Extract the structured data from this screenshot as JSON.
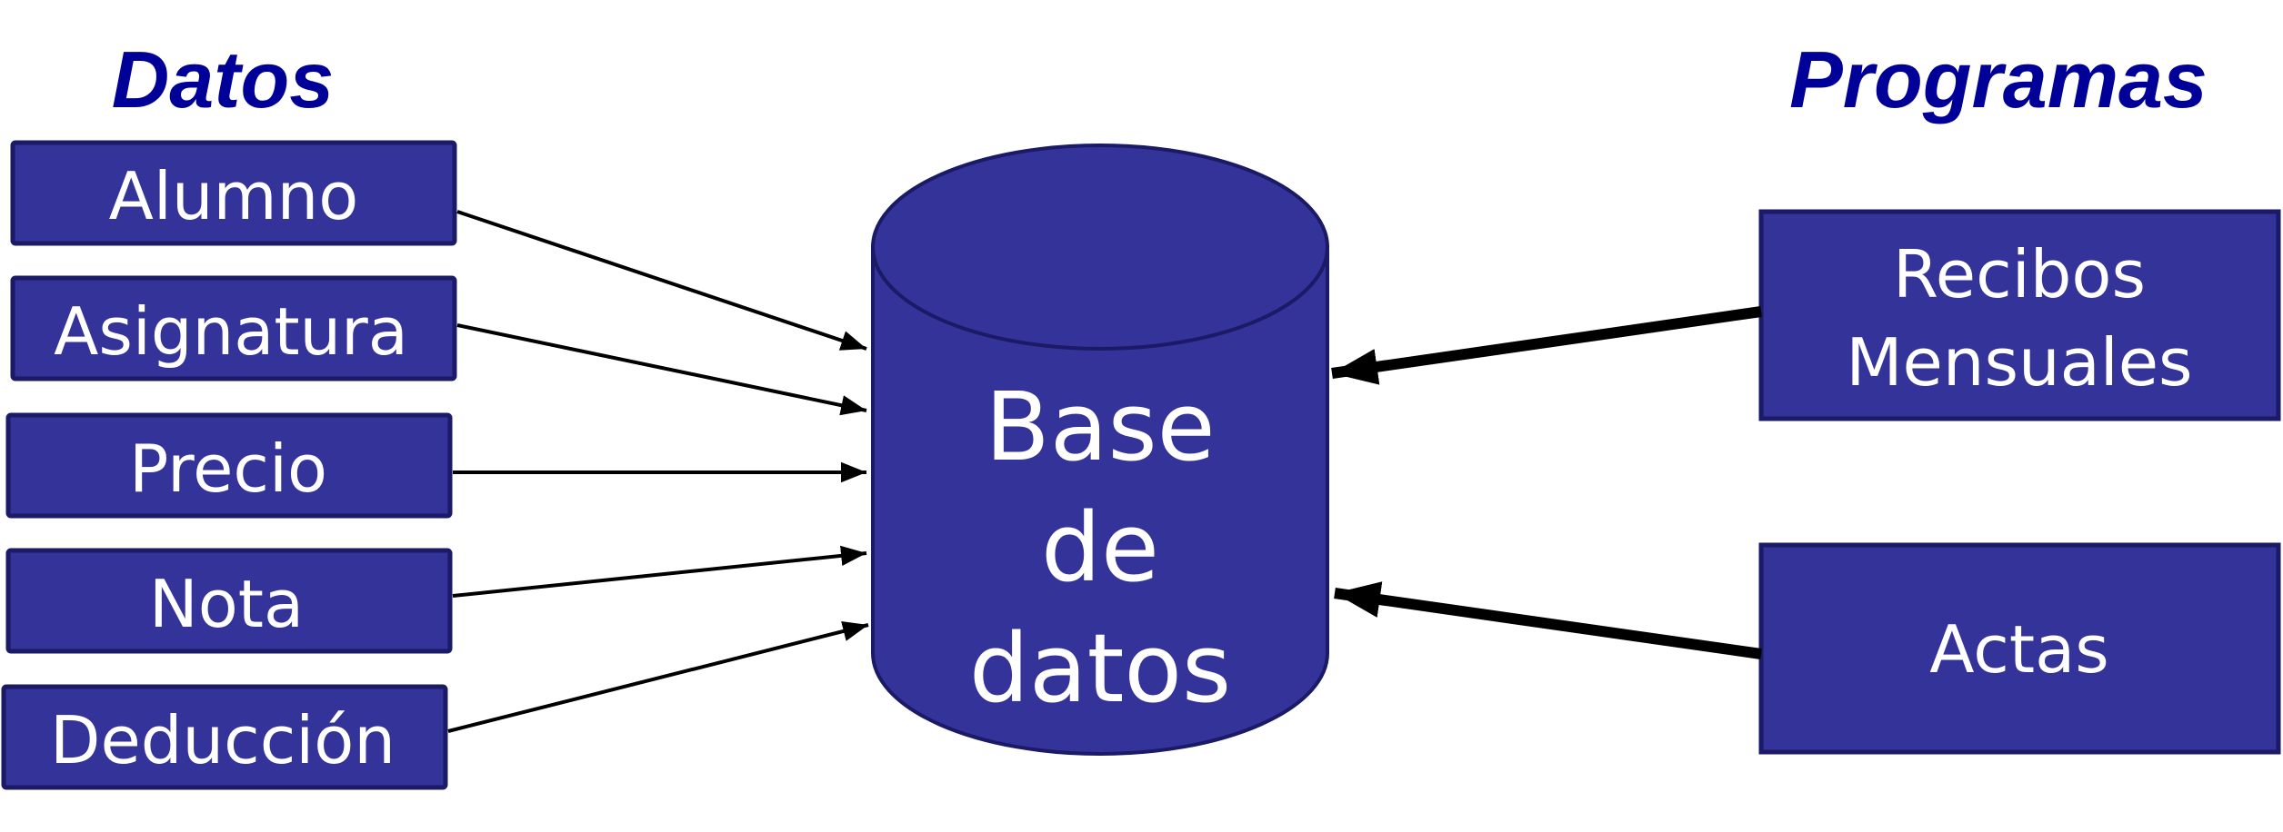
{
  "headings": {
    "left": "Datos",
    "right": "Programas"
  },
  "data_items": [
    {
      "label": "Alumno"
    },
    {
      "label": "Asignatura"
    },
    {
      "label": "Precio"
    },
    {
      "label": "Nota"
    },
    {
      "label": "Deducción"
    }
  ],
  "programs": [
    {
      "line1": "Recibos",
      "line2": "Mensuales"
    },
    {
      "line1": "Actas",
      "line2": ""
    }
  ],
  "database": {
    "line1": "Base",
    "line2": "de",
    "line3": "datos"
  },
  "colors": {
    "box_fill": "#333399",
    "heading": "#000099",
    "label": "#ffffff",
    "arrow": "#000000"
  }
}
